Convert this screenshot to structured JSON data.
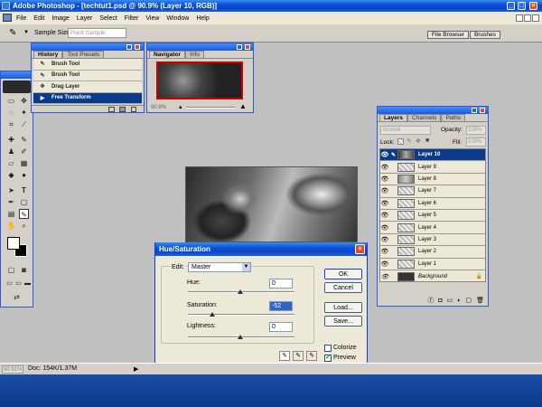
{
  "app": {
    "title": "Adobe Photoshop - [techtut1.psd @ 90.9% (Layer 10, RGB)]",
    "min": "_",
    "max": "□",
    "close": "×"
  },
  "menu": [
    "File",
    "Edit",
    "Image",
    "Layer",
    "Select",
    "Filter",
    "View",
    "Window",
    "Help"
  ],
  "options_bar": {
    "sample_size_label": "Sample Size:",
    "sample_size_value": "Point Sample",
    "file_browser": "File Browser",
    "brushes": "Brushes"
  },
  "history": {
    "tabs": [
      "History",
      "Tool Presets"
    ],
    "items": [
      "Brush Tool",
      "Brush Tool",
      "Drag Layer",
      "Free Transform"
    ],
    "selected_index": 3
  },
  "navigator": {
    "tabs": [
      "Navigator",
      "Info"
    ],
    "zoom": "90.9%"
  },
  "layers": {
    "tabs": [
      "Layers",
      "Channels",
      "Paths"
    ],
    "blend_mode": "Normal",
    "opacity_label": "Opacity:",
    "opacity_value": "100%",
    "lock_label": "Lock:",
    "fill_label": "Fill:",
    "fill_value": "100%",
    "items": [
      "Layer 10",
      "Layer 9",
      "Layer 8",
      "Layer 7",
      "Layer 6",
      "Layer 5",
      "Layer 4",
      "Layer 3",
      "Layer 2",
      "Layer 1",
      "Background"
    ],
    "selected": "Layer 10"
  },
  "hue_sat": {
    "title": "Hue/Saturation",
    "edit_label": "Edit:",
    "edit_value": "Master",
    "hue_label": "Hue:",
    "hue_value": "0",
    "saturation_label": "Saturation:",
    "saturation_value": "-52",
    "lightness_label": "Lightness:",
    "lightness_value": "0",
    "ok": "OK",
    "cancel": "Cancel",
    "load": "Load...",
    "save": "Save...",
    "colorize": "Colorize",
    "preview": "Preview",
    "colorize_checked": false,
    "preview_checked": true
  },
  "status": {
    "zoom": "90.91%",
    "doc": "Doc: 154K/1.37M"
  },
  "colors": {
    "xp_blue": "#0a50d8",
    "canvas_gray": "#c0c0c0",
    "taskbar": "#0c3a88",
    "selection": "#0a3a8c"
  }
}
